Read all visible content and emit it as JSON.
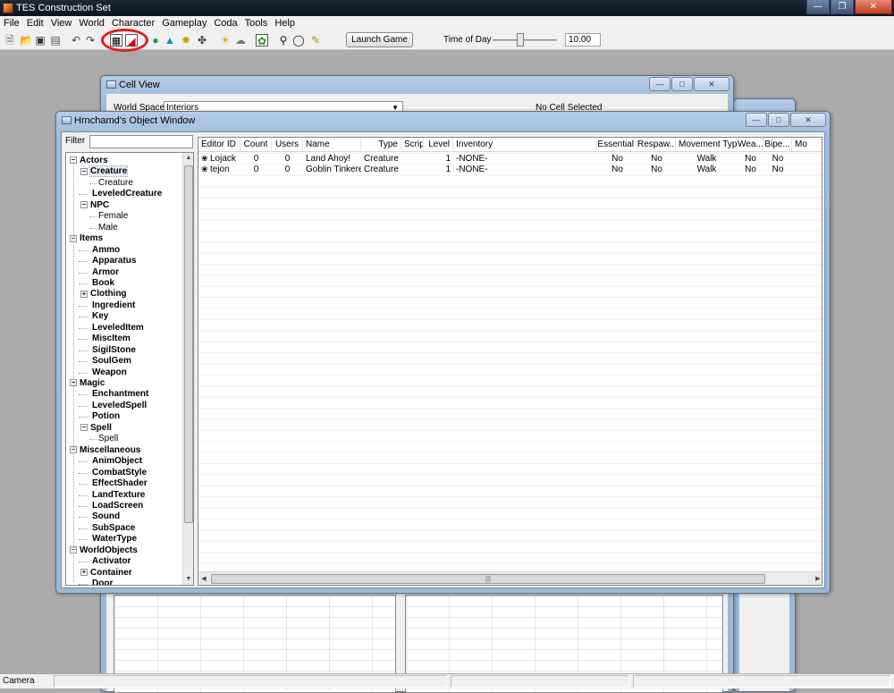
{
  "app": {
    "title": "TES Construction Set"
  },
  "menu": [
    "File",
    "Edit",
    "View",
    "World",
    "Character",
    "Gameplay",
    "Coda",
    "Tools",
    "Help"
  ],
  "toolbar": {
    "launch_label": "Launch Game",
    "time_of_day_label": "Time of Day",
    "time_of_day_value": "10.00",
    "time_of_day_fraction": 0.42
  },
  "cell_view": {
    "title": "Cell View",
    "world_space_label": "World Space",
    "world_space_value": "Interiors",
    "no_cell_text": "No Cell Selected"
  },
  "object_window": {
    "title": "Hrnchamd's Object Window",
    "filter_label": "Filter",
    "columns": [
      "Editor ID",
      "Count",
      "Users",
      "Name",
      "Type",
      "Script",
      "Level",
      "Inventory",
      "Essential",
      "Respaw...",
      "Movement Type",
      "Wea...",
      "Bipe...",
      "Mo"
    ],
    "rows": [
      {
        "editor_id": "Lojack",
        "count": "0",
        "users": "0",
        "name": "Land Ahoy!",
        "type": "Creature",
        "script": "",
        "level": "1",
        "inventory": "-NONE-",
        "essential": "No",
        "respawn": "No",
        "movement": "Walk",
        "weapon": "No",
        "biped": "No"
      },
      {
        "editor_id": "tejon",
        "count": "0",
        "users": "0",
        "name": "Goblin Tinkerer",
        "type": "Creature",
        "script": "",
        "level": "1",
        "inventory": "-NONE-",
        "essential": "No",
        "respawn": "No",
        "movement": "Walk",
        "weapon": "No",
        "biped": "No"
      }
    ],
    "tree": [
      {
        "label": "Actors",
        "bold": true,
        "depth": 0,
        "expander": "minus"
      },
      {
        "label": "Creature",
        "bold": true,
        "depth": 1,
        "expander": "minus",
        "selected": true
      },
      {
        "label": "Creature",
        "bold": false,
        "depth": 2
      },
      {
        "label": "LeveledCreature",
        "bold": true,
        "depth": 1
      },
      {
        "label": "NPC",
        "bold": true,
        "depth": 1,
        "expander": "minus"
      },
      {
        "label": "Female",
        "bold": false,
        "depth": 2
      },
      {
        "label": "Male",
        "bold": false,
        "depth": 2
      },
      {
        "label": "Items",
        "bold": true,
        "depth": 0,
        "expander": "minus"
      },
      {
        "label": "Ammo",
        "bold": true,
        "depth": 1
      },
      {
        "label": "Apparatus",
        "bold": true,
        "depth": 1
      },
      {
        "label": "Armor",
        "bold": true,
        "depth": 1
      },
      {
        "label": "Book",
        "bold": true,
        "depth": 1
      },
      {
        "label": "Clothing",
        "bold": true,
        "depth": 1,
        "expander": "plus"
      },
      {
        "label": "Ingredient",
        "bold": true,
        "depth": 1
      },
      {
        "label": "Key",
        "bold": true,
        "depth": 1
      },
      {
        "label": "LeveledItem",
        "bold": true,
        "depth": 1
      },
      {
        "label": "MiscItem",
        "bold": true,
        "depth": 1
      },
      {
        "label": "SigilStone",
        "bold": true,
        "depth": 1
      },
      {
        "label": "SoulGem",
        "bold": true,
        "depth": 1
      },
      {
        "label": "Weapon",
        "bold": true,
        "depth": 1
      },
      {
        "label": "Magic",
        "bold": true,
        "depth": 0,
        "expander": "minus"
      },
      {
        "label": "Enchantment",
        "bold": true,
        "depth": 1
      },
      {
        "label": "LeveledSpell",
        "bold": true,
        "depth": 1
      },
      {
        "label": "Potion",
        "bold": true,
        "depth": 1
      },
      {
        "label": "Spell",
        "bold": true,
        "depth": 1,
        "expander": "minus"
      },
      {
        "label": "Spell",
        "bold": false,
        "depth": 2
      },
      {
        "label": "Miscellaneous",
        "bold": true,
        "depth": 0,
        "expander": "minus"
      },
      {
        "label": "AnimObject",
        "bold": true,
        "depth": 1
      },
      {
        "label": "CombatStyle",
        "bold": true,
        "depth": 1
      },
      {
        "label": "EffectShader",
        "bold": true,
        "depth": 1
      },
      {
        "label": "LandTexture",
        "bold": true,
        "depth": 1
      },
      {
        "label": "LoadScreen",
        "bold": true,
        "depth": 1
      },
      {
        "label": "Sound",
        "bold": true,
        "depth": 1
      },
      {
        "label": "SubSpace",
        "bold": true,
        "depth": 1
      },
      {
        "label": "WaterType",
        "bold": true,
        "depth": 1
      },
      {
        "label": "WorldObjects",
        "bold": true,
        "depth": 0,
        "expander": "minus"
      },
      {
        "label": "Activator",
        "bold": true,
        "depth": 1
      },
      {
        "label": "Container",
        "bold": true,
        "depth": 1,
        "expander": "plus"
      },
      {
        "label": "Door",
        "bold": true,
        "depth": 1
      }
    ]
  },
  "statusbar": {
    "text": "Camera"
  },
  "colors": {
    "highlight_ring": "#e02020",
    "window_frame": "#9fbbd9",
    "desktop": "#ababab"
  }
}
